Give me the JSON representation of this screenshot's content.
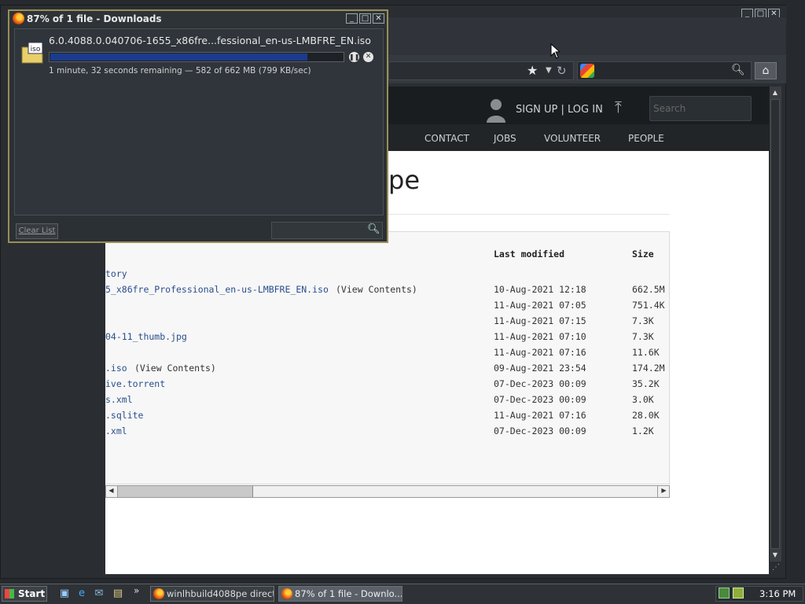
{
  "downloads_window": {
    "title": "87% of 1 file - Downloads",
    "download": {
      "filename": "6.0.4088.0.040706-1655_x86fre...fessional_en-us-LMBFRE_EN.iso",
      "status": "1 minute, 32 seconds remaining — 582 of 662 MB (799 KB/sec)",
      "progress_fraction": 0.88,
      "file_icon_label": "iso"
    },
    "clear_list_label": "Clear List",
    "search_icon": "magnifier-icon"
  },
  "browser": {
    "nav": {
      "star_icon": "bookmark-star-icon",
      "reload_icon": "reload-icon",
      "home_icon": "home-icon",
      "search_engine_icon": "google-icon"
    },
    "site": {
      "signup": "SIGN UP | LOG IN",
      "search_placeholder": "Search",
      "nav_items": [
        "CONTACT",
        "JOBS",
        "VOLUNTEER",
        "PEOPLE"
      ],
      "heading_fragment": "pe"
    },
    "listing": {
      "headers": {
        "modified": "Last modified",
        "size": "Size"
      },
      "rows": [
        {
          "name": "tory",
          "view": "",
          "date": "",
          "size": ""
        },
        {
          "name": "5_x86fre_Professional_en-us-LMBFRE_EN.iso",
          "view": "(View Contents)",
          "date": "10-Aug-2021 12:18",
          "size": "662.5M"
        },
        {
          "name": "",
          "view": "",
          "date": "11-Aug-2021 07:05",
          "size": "751.4K"
        },
        {
          "name": "",
          "view": "",
          "date": "11-Aug-2021 07:15",
          "size": "7.3K"
        },
        {
          "name": "04-11_thumb.jpg",
          "view": "",
          "date": "11-Aug-2021 07:10",
          "size": "7.3K"
        },
        {
          "name": "",
          "view": "",
          "date": "11-Aug-2021 07:16",
          "size": "11.6K"
        },
        {
          "name": ".iso",
          "view": "(View Contents)",
          "date": "09-Aug-2021 23:54",
          "size": "174.2M"
        },
        {
          "name": "ive.torrent",
          "view": "",
          "date": "07-Dec-2023 00:09",
          "size": "35.2K"
        },
        {
          "name": "s.xml",
          "view": "",
          "date": "07-Dec-2023 00:09",
          "size": "3.0K"
        },
        {
          "name": ".sqlite",
          "view": "",
          "date": "11-Aug-2021 07:16",
          "size": "28.0K"
        },
        {
          "name": ".xml",
          "view": "",
          "date": "07-Dec-2023 00:09",
          "size": "1.2K"
        }
      ]
    }
  },
  "taskbar": {
    "start_label": "Start",
    "tasks": [
      {
        "label": "winlhbuild4088pe director...",
        "active": false
      },
      {
        "label": "87% of 1 file - Downlo...",
        "active": true
      }
    ],
    "clock": "3:16 PM"
  }
}
